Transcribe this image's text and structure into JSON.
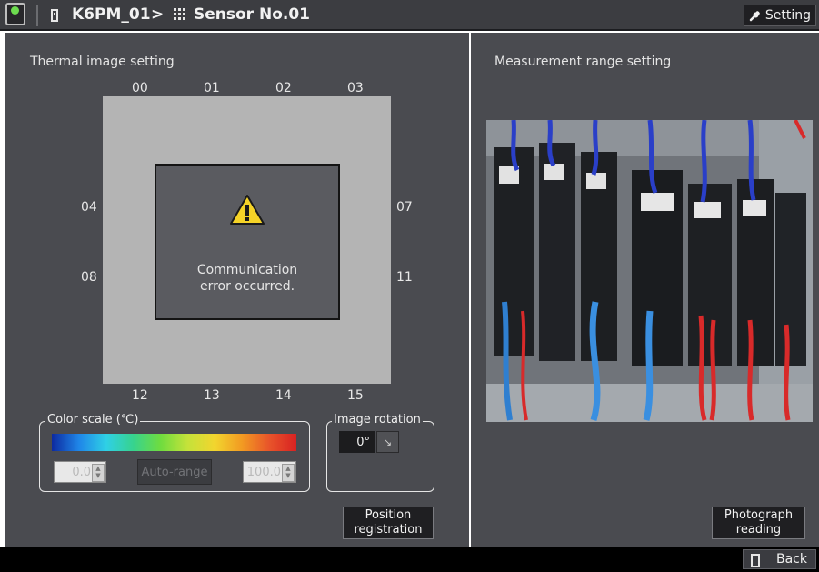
{
  "header": {
    "device_name": "K6PM_01",
    "separator": ">",
    "sensor_name": "Sensor No.01",
    "setting_label": "Setting"
  },
  "thermal": {
    "title": "Thermal image setting",
    "top_labels": [
      "00",
      "01",
      "02",
      "03"
    ],
    "left_labels": [
      "04",
      "08"
    ],
    "right_labels": [
      "07",
      "11"
    ],
    "bottom_labels": [
      "12",
      "13",
      "14",
      "15"
    ],
    "error_line1": "Communication",
    "error_line2": "error occurred."
  },
  "color_scale": {
    "legend": "Color scale (℃)",
    "min_value": "0.0",
    "max_value": "100.0",
    "auto_range_label": "Auto-range"
  },
  "rotation": {
    "legend": "Image rotation",
    "value": "0°"
  },
  "position_registration": {
    "line1": "Position",
    "line2": "registration"
  },
  "measurement": {
    "title": "Measurement range setting",
    "photo_line1": "Photograph",
    "photo_line2": "reading"
  },
  "footer": {
    "back_label": "Back"
  },
  "icons": {
    "app": "app-status-icon",
    "device": "device-icon",
    "sensor": "sensor-grid-icon",
    "setting": "wrench-icon",
    "warning": "warning-icon",
    "back": "device-icon"
  },
  "colors": {
    "topbar": "#3c3d41",
    "panel": "#4a4b50",
    "thermal_area": "#b4b4b4",
    "warning": "#f5d327"
  }
}
